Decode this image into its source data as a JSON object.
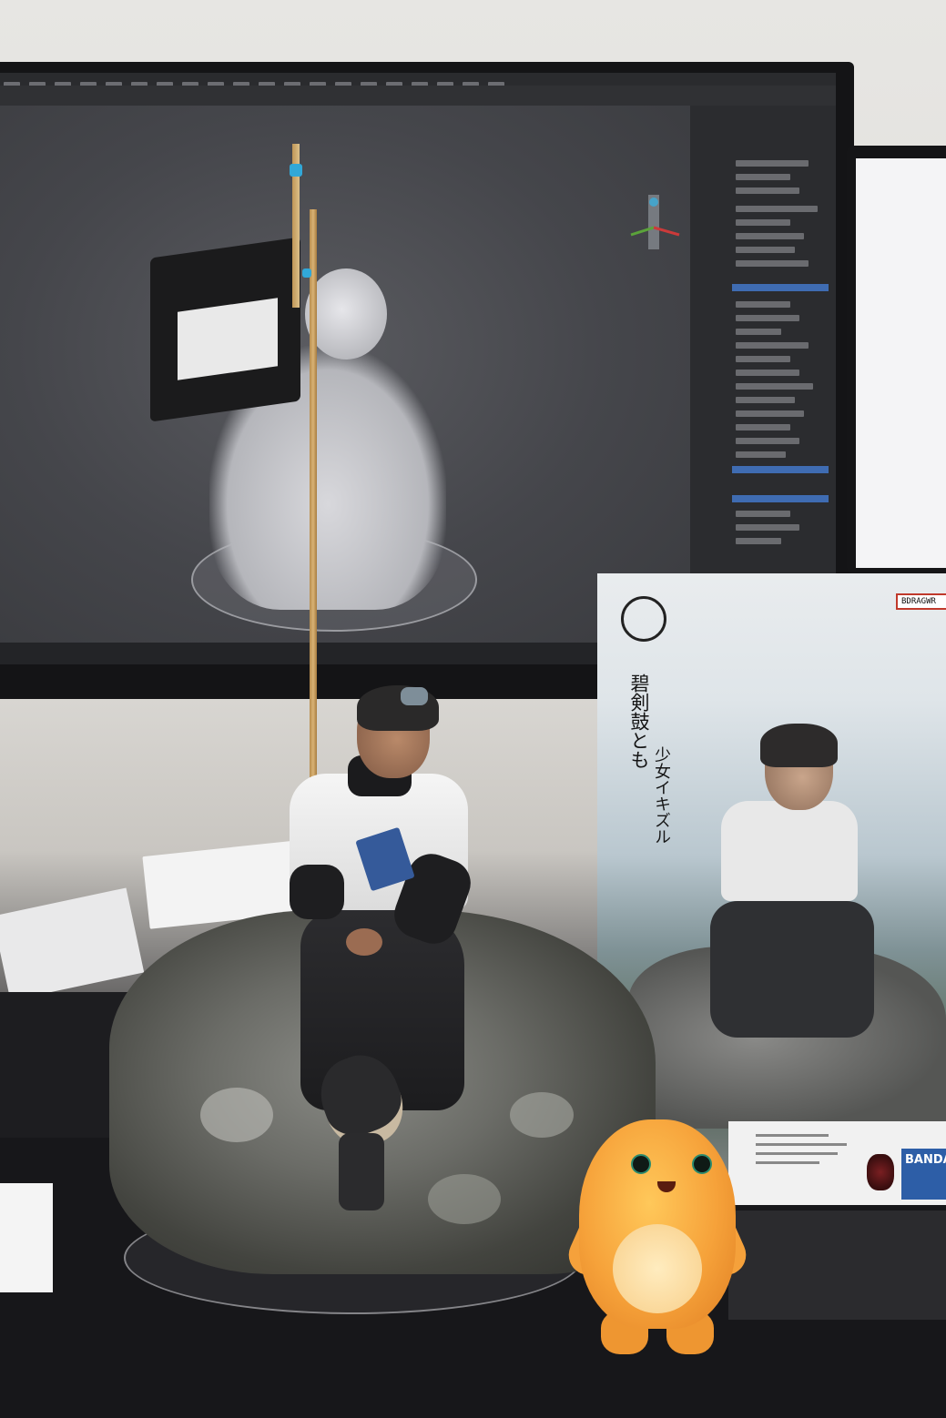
{
  "box": {
    "product_code": "BDRAGWR",
    "title_line1": "碧剣鼓とも",
    "title_line2": "少女イキズル",
    "brand": "BANDAI"
  },
  "colors": {
    "mascot": "#f6a23a",
    "flag_tie": "#31a8d8",
    "box_code_border": "#c0392b",
    "bandai_blue": "#2d5ea7"
  },
  "icons": {
    "box_logo": "circle-emblem-icon",
    "box_sublogo": "tamashii-logo-icon",
    "viewport_gizmo": "axis-gizmo-icon"
  }
}
